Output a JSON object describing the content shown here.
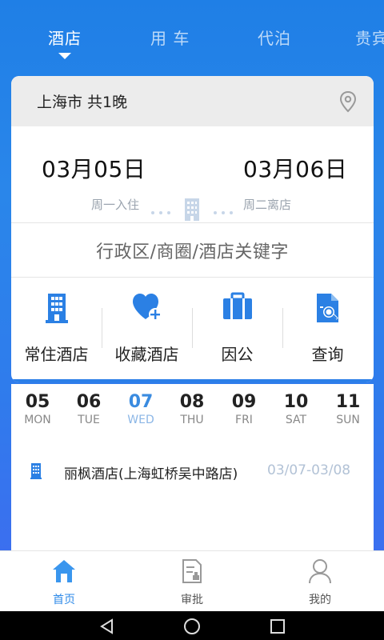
{
  "colors": {
    "primary": "#2a86ea",
    "accent": "#3a8be0",
    "muted": "#9aa3ae"
  },
  "top_tabs": [
    {
      "label": "酒店",
      "active": true
    },
    {
      "label": "用 车",
      "active": false
    },
    {
      "label": "代泊",
      "active": false
    },
    {
      "label": "贵宾",
      "active": false
    }
  ],
  "booking": {
    "city_nights": "上海市 共1晚",
    "checkin_date": "03月05日",
    "checkin_label": "周一入住",
    "checkout_date": "03月06日",
    "checkout_label": "周二离店",
    "keyword_placeholder": "行政区/商圈/酒店关键字"
  },
  "quick_actions": [
    {
      "label": "常住酒店",
      "icon": "building-icon"
    },
    {
      "label": "收藏酒店",
      "icon": "heart-plus-icon"
    },
    {
      "label": "因公",
      "icon": "briefcase-icon"
    },
    {
      "label": "查询",
      "icon": "document-search-icon"
    }
  ],
  "week": [
    {
      "num": "05",
      "name": "MON"
    },
    {
      "num": "06",
      "name": "TUE"
    },
    {
      "num": "07",
      "name": "WED",
      "today": true
    },
    {
      "num": "08",
      "name": "THU"
    },
    {
      "num": "09",
      "name": "FRI"
    },
    {
      "num": "10",
      "name": "SAT"
    },
    {
      "num": "11",
      "name": "SUN"
    }
  ],
  "trip": {
    "hotel_name": "丽枫酒店(上海虹桥吴中路店)",
    "dates": "03/07-03/08"
  },
  "bottom_nav": [
    {
      "label": "首页",
      "icon": "home-icon",
      "active": true
    },
    {
      "label": "审批",
      "icon": "approval-icon",
      "active": false
    },
    {
      "label": "我的",
      "icon": "user-icon",
      "active": false
    }
  ]
}
